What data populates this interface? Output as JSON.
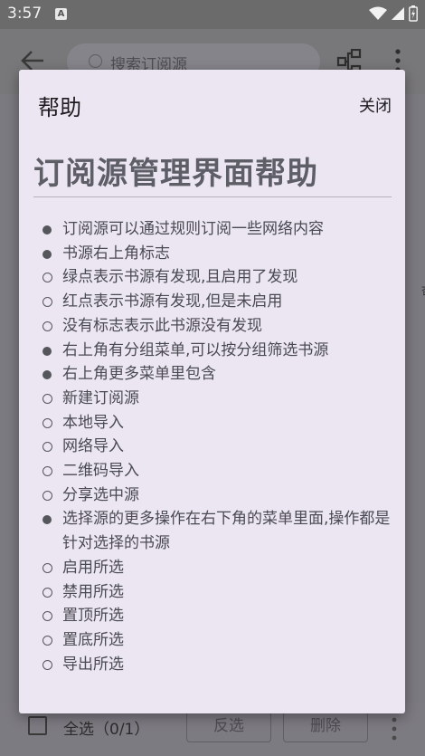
{
  "status_bar": {
    "time": "3:57",
    "notification_letter": "A"
  },
  "app_bar": {
    "search_placeholder": "搜索订阅源"
  },
  "background": {
    "side_char": "杏"
  },
  "bottom_bar": {
    "select_all": "全选（0/1）",
    "invert": "反选",
    "delete": "删除"
  },
  "dialog": {
    "title": "帮助",
    "close": "关闭",
    "heading": "订阅源管理界面帮助",
    "items": [
      {
        "text": "订阅源可以通过规则订阅一些网络内容",
        "children": []
      },
      {
        "text": "书源右上角标志",
        "children": [
          "绿点表示书源有发现,且启用了发现",
          "红点表示书源有发现,但是未启用",
          "没有标志表示此书源没有发现"
        ]
      },
      {
        "text": "右上角有分组菜单,可以按分组筛选书源",
        "children": []
      },
      {
        "text": "右上角更多菜单里包含",
        "children": [
          "新建订阅源",
          "本地导入",
          "网络导入",
          "二维码导入",
          "分享选中源"
        ]
      },
      {
        "text": "选择源的更多操作在右下角的菜单里面,操作都是针对选择的书源",
        "children": [
          "启用所选",
          "禁用所选",
          "置顶所选",
          "置底所选",
          "导出所选"
        ]
      }
    ]
  }
}
